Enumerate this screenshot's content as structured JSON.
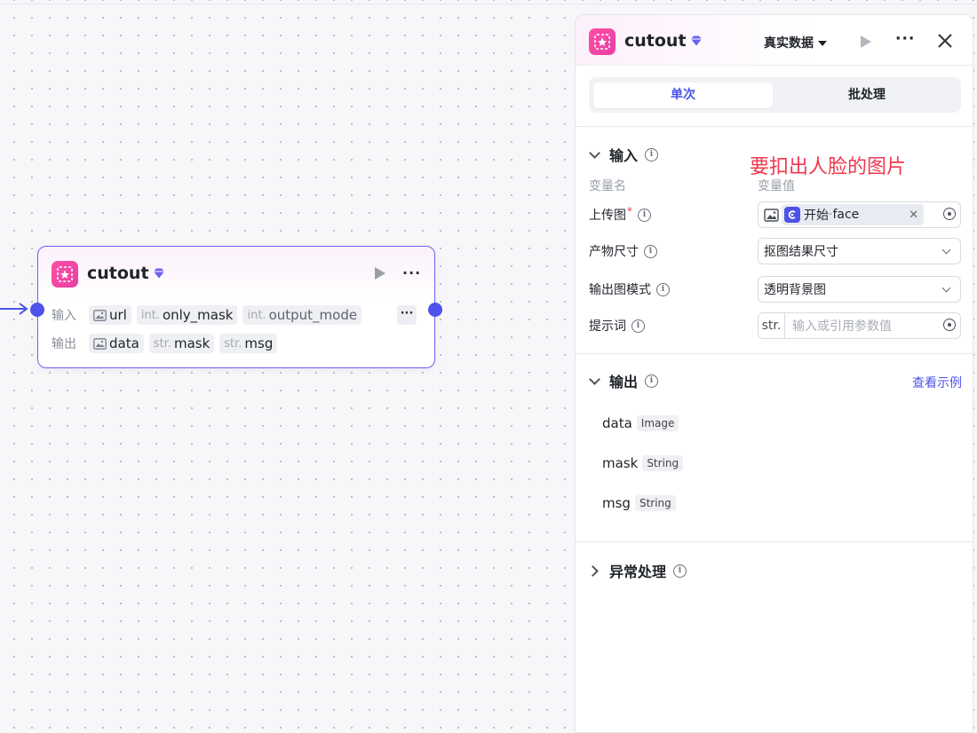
{
  "node": {
    "title": "cutout",
    "input_label": "输入",
    "output_label": "输出",
    "inputs": [
      {
        "type": "",
        "name": "url"
      },
      {
        "type": "int.",
        "name": "only_mask"
      },
      {
        "type": "int.",
        "name": "output_mode"
      }
    ],
    "outputs": [
      {
        "type": "",
        "name": "data"
      },
      {
        "type": "str.",
        "name": "mask"
      },
      {
        "type": "str.",
        "name": "msg"
      }
    ],
    "more": "···"
  },
  "panel": {
    "title": "cutout",
    "data_select": "真实数据",
    "tabs": {
      "single": "单次",
      "batch": "批处理"
    },
    "input_section": {
      "title": "输入",
      "annotation": "要扣出人脸的图片",
      "col_name": "变量名",
      "col_value": "变量值",
      "rows": [
        {
          "label": "上传图",
          "required": "*",
          "ref_source": "开始",
          "ref_sep": " · ",
          "ref_var": "face"
        },
        {
          "label": "产物尺寸",
          "value": "抠图结果尺寸"
        },
        {
          "label": "输出图模式",
          "value": "透明背景图"
        },
        {
          "label": "提示词",
          "type_tag": "str.",
          "placeholder": "输入或引用参数值"
        }
      ]
    },
    "output_section": {
      "title": "输出",
      "example_link": "查看示例",
      "items": [
        {
          "name": "data",
          "type": "Image"
        },
        {
          "name": "mask",
          "type": "String"
        },
        {
          "name": "msg",
          "type": "String"
        }
      ]
    },
    "error_section": {
      "title": "异常处理"
    }
  },
  "colors": {
    "accent": "#4d53e8",
    "brand_pink": "#ff4fa3",
    "annotation_red": "#f0384f"
  }
}
